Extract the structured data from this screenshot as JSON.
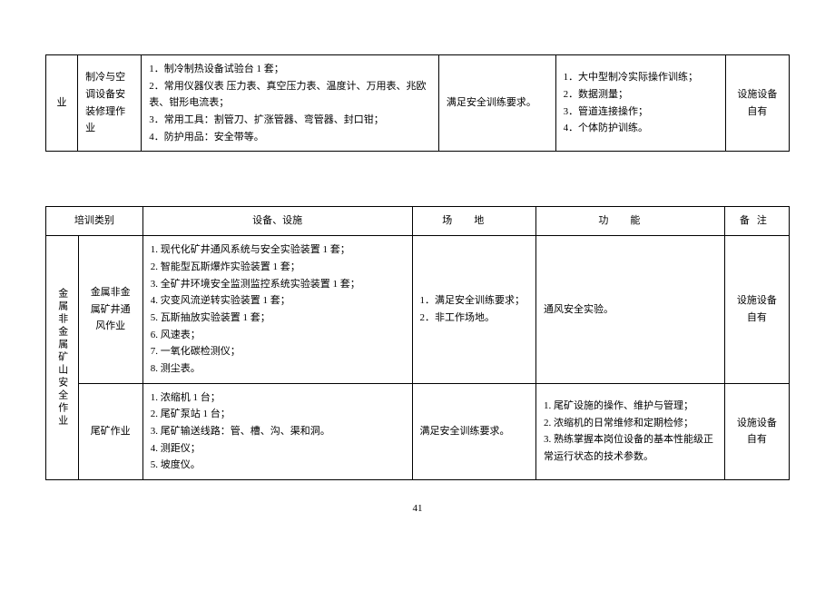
{
  "table1": {
    "col1": "业",
    "col2": "制冷与空调设备安装修理作业",
    "equip": [
      "1．制冷制热设备试验台 1 套；",
      "2．常用仪器仪表 压力表、真空压力表、温度计、万用表、兆欧表、钳形电流表；",
      "3．常用工具：割管刀、扩涨管器、弯管器、封口钳；",
      "4．防护用品：安全带等。"
    ],
    "site": "满足安全训练要求。",
    "func": [
      "1．大中型制冷实际操作训练；",
      "2．数据测量；",
      "3．管道连接操作；",
      "4．个体防护训练。"
    ],
    "note": "设施设备自有"
  },
  "table2": {
    "headers": {
      "cat": "培训类别",
      "equip": "设备、设施",
      "site": "场地",
      "func": "功能",
      "note": "备注"
    },
    "catMain": "金属非金属矿山安全作业",
    "row1": {
      "sub": "金属非金属矿井通风作业",
      "equip": [
        "1. 现代化矿井通风系统与安全实验装置 1 套；",
        "2. 智能型瓦斯爆炸实验装置 1 套；",
        "3. 全矿井环境安全监测监控系统实验装置 1 套；",
        "4. 灾变风流逆转实验装置 1 套；",
        "5. 瓦斯抽放实验装置 1 套；",
        "6. 风速表；",
        "7. 一氧化碳检测仪；",
        "8. 测尘表。"
      ],
      "site": [
        "1．满足安全训练要求；",
        "2．非工作场地。"
      ],
      "func": "通风安全实验。",
      "note": "设施设备自有"
    },
    "row2": {
      "sub": "尾矿作业",
      "equip": [
        "1. 浓缩机 1 台；",
        "2. 尾矿泵站 1 台；",
        "3. 尾矿输送线路：管、槽、沟、渠和洞。",
        "4. 测距仪；",
        "5. 坡度仪。"
      ],
      "site": "满足安全训练要求。",
      "func": [
        "1. 尾矿设施的操作、维护与管理；",
        "2. 浓缩机的日常维修和定期检修；",
        "3. 熟练掌握本岗位设备的基本性能级正常运行状态的技术参数。"
      ],
      "note": "设施设备自有"
    }
  },
  "pagenum": "41"
}
